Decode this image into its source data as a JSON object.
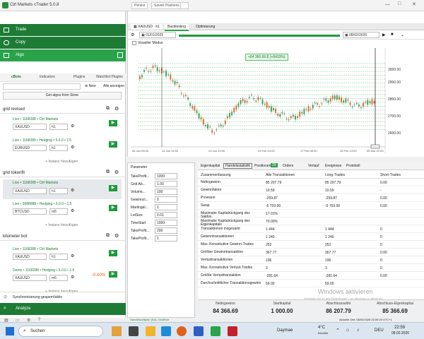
{
  "window": {
    "title": "Ctrl Markets cTrader 5.0.8"
  },
  "titlebar": {
    "search": "Search",
    "btn1": "Persist",
    "btn2": "Saved Positions"
  },
  "nav": {
    "trade": "Trade",
    "copy": "Copy",
    "algo": "Algo"
  },
  "algo_tabs": [
    "cBots",
    "Indicators",
    "Plugins",
    "Watchlist Plugins"
  ],
  "algo_toolbar": {
    "new": "New",
    "all": "Alle anzeigen",
    "get": "Get algos from Store"
  },
  "groups": [
    {
      "name": "grid revised",
      "bots": [
        {
          "line": "Live • 1168288 • Ctrl Markets",
          "symbol": "XAUUSD",
          "tf": "h1"
        },
        {
          "line": "Live • 1168289 • Hedging • 5.0.0 • 1:5",
          "symbol": "EURUSD",
          "tf": "h1"
        }
      ],
      "add": "Instanz hinzufügen"
    },
    {
      "name": "grid tokenflt",
      "bots": [
        {
          "line": "Live • 1168288 • Ctrl Markets",
          "symbol": "XAUUSD",
          "tf": "h1"
        },
        {
          "line": "Live • 5688888 • Hedging • 5.0.0 • 1:5",
          "symbol": "BTCUSD",
          "tf": "m5"
        }
      ],
      "add": "Instanz hinzufügen"
    },
    {
      "name": "kilometer bot",
      "bots": [
        {
          "line": "Live • 1168288 • Ctrl Markets",
          "symbol": "XAUUSD",
          "tf": "h1"
        },
        {
          "line": "Demo • 1168288 • Hedging • 5.0.0 • 1:5",
          "symbol": "XAUUSD",
          "tf": "m5",
          "pct": "-0.00%"
        }
      ],
      "add": "Instanz hinzufügen"
    }
  ],
  "left_footer": {
    "sync": "Synchronisierung gesperrt/aktiv",
    "analyze": "Analyze"
  },
  "chart": {
    "tabs": [
      "XAUUSD · h1",
      "Backtesting",
      "Optimierung"
    ],
    "symbol_sel": "XAUUSD",
    "date_from": "01/01/2025",
    "date_to": "08/02/2026",
    "visual_mode": "Visueller Modus",
    "badge": "+84 366.69 $ (+8433%)",
    "price_labels": [
      "3000.00",
      "2900.00",
      "2800.00",
      "2700.00",
      "2600.00"
    ],
    "time_labels": [
      "06 Jan 06:00",
      "14 Jan 14:00",
      "23 Jan 23:00",
      "03 Feb 13:00",
      "17 Feb 06:00",
      "25 Feb 14:00",
      "05 Mar 22:00"
    ]
  },
  "params": {
    "header": "Parameter",
    "rows": [
      {
        "label": "TakeProfit...",
        "value": "1000"
      },
      {
        "label": "Grid Ab...",
        "value": "1.00"
      },
      {
        "label": "Volume...",
        "value": "100"
      },
      {
        "label": "Gewinnzi...",
        "value": "0"
      },
      {
        "label": "Martingal...",
        "value": "1"
      },
      {
        "label": "LotSize",
        "value": "0.01"
      },
      {
        "label": "TimeStart",
        "value": "1000"
      },
      {
        "label": "TakeProfit...",
        "value": "200"
      },
      {
        "label": "TakeProfit...",
        "value": "1"
      }
    ]
  },
  "stats": {
    "tabs": [
      "Eigenkapital",
      "Handelsstatistik",
      "Positionen",
      "Orders",
      "Verlauf",
      "Ereignisse",
      "Protokoll"
    ],
    "positions_count": "29",
    "headers": [
      "Zusammenfassung",
      "Alle Transaktionen",
      "Long-Trades",
      "Short-Trades"
    ],
    "rows": [
      [
        "Nettogewinn",
        "85 207.79",
        "85 207.79",
        "0.00"
      ],
      [
        "Gewinnfaktor",
        "10.59",
        "10.59",
        "-"
      ],
      [
        "Provision",
        "-259.87",
        "-259.87",
        "0.00"
      ],
      [
        "Swap",
        "-5 703.00",
        "-5 703.00",
        "0.00"
      ],
      [
        "Maximaler Kapitalrückgang des Saldos",
        "17.01%",
        "",
        ""
      ],
      [
        "Maximaler Kapitalrückgang des Eigenkapitals",
        "70.00%",
        "",
        ""
      ],
      [
        "Transaktionen insgesamt",
        "1 444",
        "1 444",
        "0"
      ],
      [
        "Gewinntransaktionen",
        "1 240",
        "1 240",
        "0"
      ],
      [
        "Max. Konsekutive Gewinn-Trades",
        "252",
        "252",
        "0"
      ],
      [
        "Größter Gewinntransaktion",
        "367.77",
        "367.77",
        "0.00"
      ],
      [
        "Verlusttransaktionen",
        "196",
        "196",
        "0"
      ],
      [
        "Max. Konsekutive Verlust-Trades",
        "3",
        "3",
        "0"
      ],
      [
        "Größte Verlusttransaktion",
        "-281.64",
        "-281.64",
        "0.00"
      ],
      [
        "Durchschnittlicher Transaktionsgewinn",
        "59.00",
        "59.00",
        ""
      ]
    ],
    "footer": [
      {
        "label": "Nettogewinn",
        "value": "84 366.69"
      },
      {
        "label": "Startkapital",
        "value": "1 000.00"
      },
      {
        "label": "Abschlusssaldo",
        "value": "86 207.79"
      },
      {
        "label": "Abschluss-Eigenkapital",
        "value": "85 366.69"
      }
    ],
    "watermark_title": "Windows aktivieren",
    "watermark_sub": "Wechseln Sie zu den Einstellungen, um Windows zu aktivieren."
  },
  "statusbar": {
    "left": "Handelszeitplan (EA): Geöffnet",
    "right": "Aktuelle Zeit: 08/02/2026 22:59:20 UTC+1"
  },
  "taskbar": {
    "search": "Suchen",
    "weather": "4°C",
    "weather_sub": "Bewölkt",
    "lang": "DEU",
    "time": "22:59",
    "date": "08.02.2026",
    "news": "Daymae"
  }
}
